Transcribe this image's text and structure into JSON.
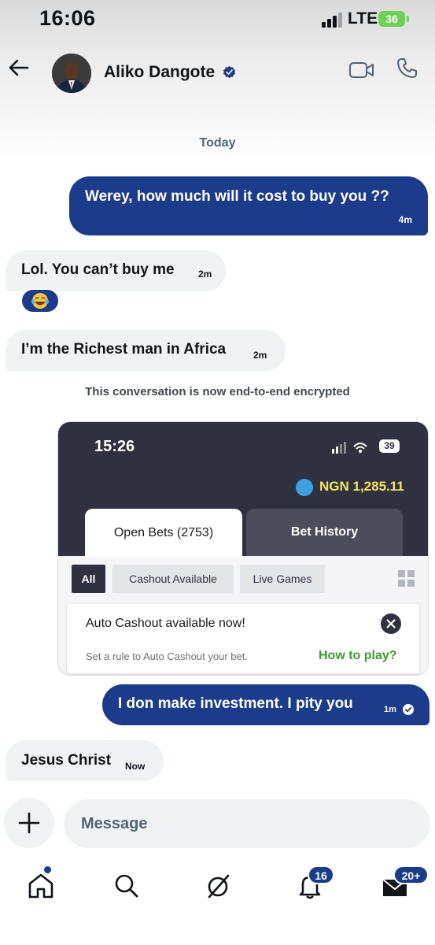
{
  "status_bar": {
    "time": "16:06",
    "network": "LTE",
    "battery": "36"
  },
  "header": {
    "contact_name": "Aliko Dangote",
    "verified": true,
    "icons": [
      "back-arrow-icon",
      "verified-badge-icon",
      "video-call-icon",
      "phone-call-icon"
    ]
  },
  "chat": {
    "date_label": "Today",
    "messages": [
      {
        "direction": "outgoing",
        "text": "Werey, how much will it cost to buy you ??",
        "time": "4m"
      },
      {
        "direction": "incoming",
        "text": "Lol. You can’t buy me",
        "time": "2m",
        "reaction": "😂"
      },
      {
        "direction": "incoming",
        "text": "I’m the Richest man in Africa",
        "time": "2m"
      },
      {
        "direction": "outgoing",
        "text": "I don make investment. I pity you",
        "time": "1m",
        "read": true
      },
      {
        "direction": "incoming",
        "text": "Jesus Christ",
        "time": "Now"
      }
    ],
    "encryption_note": "This conversation is now end-to-end encrypted"
  },
  "shared_screenshot": {
    "time": "15:26",
    "battery": "39",
    "balance": "NGN 1,285.11",
    "tabs": [
      "Open Bets (2753)",
      "Bet History"
    ],
    "filters": [
      "All",
      "Cashout Available",
      "Live Games"
    ],
    "banner_title": "Auto Cashout available now!",
    "banner_subtitle": "Set a rule to Auto Cashout your bet.",
    "banner_link": "How to play?"
  },
  "composer": {
    "placeholder": "Message"
  },
  "tab_bar": {
    "items": [
      "home-icon",
      "search-icon",
      "grok-icon",
      "notifications-icon",
      "messages-icon"
    ],
    "notifications_badge": "16",
    "messages_badge": "20+"
  },
  "colors": {
    "accent": "#1d3b8b",
    "bubble_incoming": "#eff3f4",
    "bet_dark": "#2f3140",
    "bet_green": "#3c9a2e"
  }
}
